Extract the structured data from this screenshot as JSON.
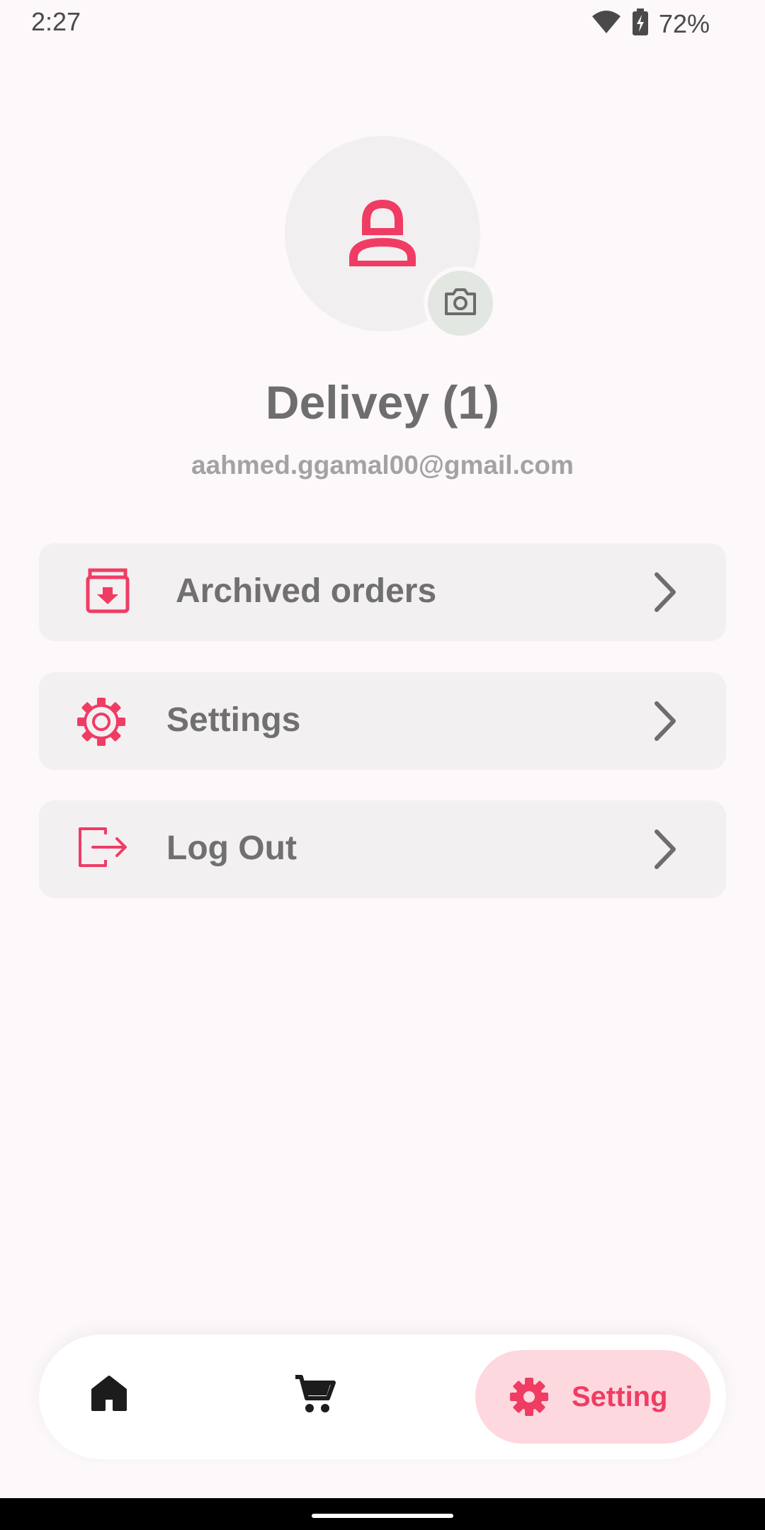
{
  "status_bar": {
    "time": "2:27",
    "battery_percent": "72%",
    "icons": [
      "wifi-icon",
      "battery-charging-icon"
    ]
  },
  "profile": {
    "avatar_icon": "person-icon",
    "camera_icon": "camera-icon",
    "name": "Delivey (1)",
    "email": "aahmed.ggamal00@gmail.com"
  },
  "menu": {
    "items": [
      {
        "label": "Archived orders",
        "icon": "archive-icon"
      },
      {
        "label": "Settings",
        "icon": "gear-outline-icon"
      },
      {
        "label": "Log Out",
        "icon": "logout-icon"
      }
    ]
  },
  "bottom_nav": {
    "items": [
      {
        "icon": "home-icon",
        "label": ""
      },
      {
        "icon": "cart-icon",
        "label": ""
      },
      {
        "icon": "gear-icon",
        "label": "Setting",
        "selected": true
      }
    ]
  },
  "colors": {
    "accent": "#f03c63",
    "selected_pill": "#fdd8de",
    "card_bg": "#f3f0f2",
    "text": "#707070"
  }
}
